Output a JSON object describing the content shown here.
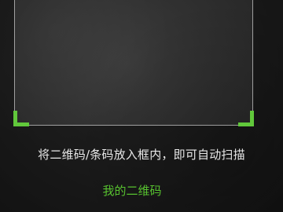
{
  "scanner": {
    "hint_text": "将二维码/条码放入框内，即可自动扫描",
    "my_qrcode_link": "我的二维码",
    "accent_color": "#61c83b",
    "link_color": "#57c12f"
  }
}
